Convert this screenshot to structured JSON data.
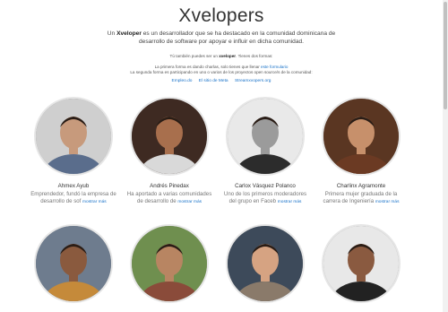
{
  "title": "Xvelopers",
  "intro": {
    "prefix": "Un ",
    "bold": "Xveloper",
    "suffix": " es un desarrollador que se ha destacado en la comunidad dominicana de desarrollo de software por apoyar e influir en dicha comunidad."
  },
  "you_too": {
    "prefix": "Tú también puedes ser un ",
    "bold": "xveloper",
    "suffix": ". Tienes dos formas:"
  },
  "forms": {
    "first_prefix": "La primera forma es dando charlas, solo tienes que llenar ",
    "first_link": "este formulario",
    "second": "La segunda forma es participando en uno o varios de los proyectos open source/s de la comunidad:"
  },
  "projects": [
    "Empleo.do",
    "El sitio de Meta",
    "Streamxvopers.org"
  ],
  "more_label": "mostrar más",
  "people": [
    {
      "name": "Ahmex Ayub",
      "desc": "Emprendedor, fundó la empresa de desarrollo de sof",
      "skin": "#c79a7c",
      "bg": "#cfcfcf",
      "shirt": "#5a6d8c"
    },
    {
      "name": "Andrés Pinedax",
      "desc": "Ha aportado a varias comunidades de desarrollo de",
      "skin": "#a86f4d",
      "bg": "#3e2a22",
      "shirt": "#d9d9d9"
    },
    {
      "name": "Carlox Vásquez Polanco",
      "desc": "Uno de los primeros moderadores del grupo en Faceb",
      "skin": "#9b9b9b",
      "bg": "#e9e9e9",
      "shirt": "#2c2c2c"
    },
    {
      "name": "Charlinx Agramonte",
      "desc": "Primera mujer graduada de la carrera de Ingeniería",
      "skin": "#c7906b",
      "bg": "#5a3622",
      "shirt": "#6b3a23"
    },
    {
      "name": "",
      "desc": "",
      "skin": "#8a5a3e",
      "bg": "#6e7c8e",
      "shirt": "#c58a3a"
    },
    {
      "name": "",
      "desc": "",
      "skin": "#b88562",
      "bg": "#6f8f4f",
      "shirt": "#8a4b3a"
    },
    {
      "name": "",
      "desc": "",
      "skin": "#d6a382",
      "bg": "#3d4a5a",
      "shirt": "#8a7a6a"
    },
    {
      "name": "",
      "desc": "",
      "skin": "#8a5a40",
      "bg": "#e8e8e8",
      "shirt": "#222222"
    }
  ]
}
